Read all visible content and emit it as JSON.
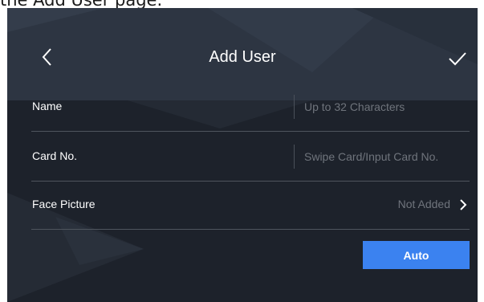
{
  "caption": "the Add User page.",
  "header": {
    "title": "Add User"
  },
  "form": {
    "name": {
      "label": "Name",
      "placeholder": "Up to 32 Characters"
    },
    "card": {
      "label": "Card No.",
      "placeholder": "Swipe Card/Input Card No."
    },
    "face": {
      "label": "Face Picture",
      "status": "Not Added"
    }
  },
  "actions": {
    "auto_label": "Auto"
  },
  "colors": {
    "background": "#1d222b",
    "accent": "#3b82f0",
    "placeholder": "#6f747c"
  },
  "icons": {
    "back": "chevron-left-icon",
    "confirm": "check-icon",
    "face_arrow": "chevron-right-icon"
  }
}
